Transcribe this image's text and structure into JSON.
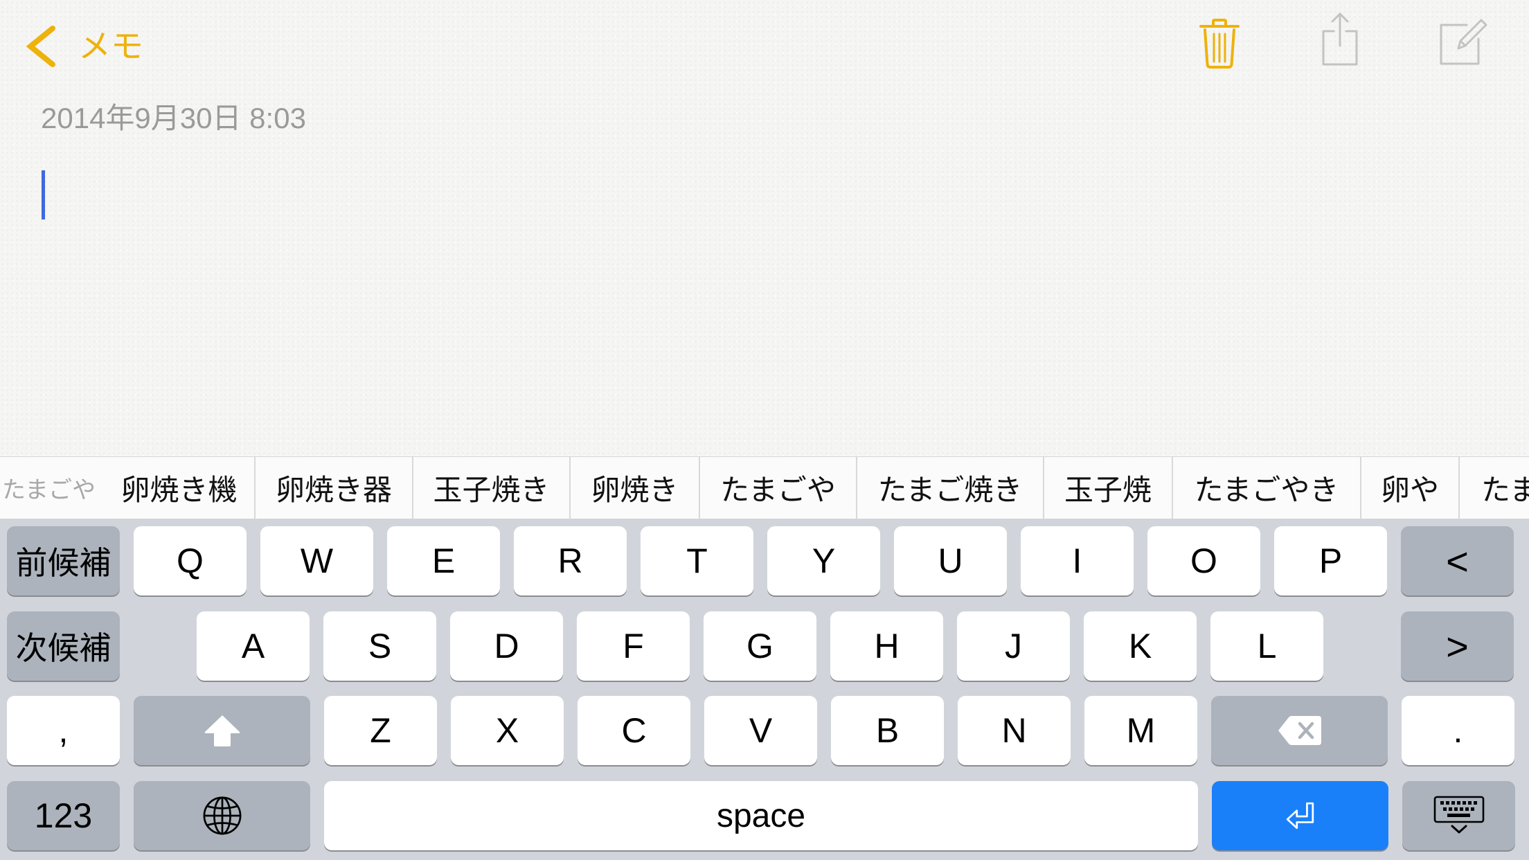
{
  "nav": {
    "back_label": "メモ",
    "back_icon": "chevron-left-icon",
    "trash_icon": "trash-icon",
    "share_icon": "share-icon",
    "compose_icon": "compose-icon"
  },
  "note": {
    "date": "2014年9月30日 8:03"
  },
  "candidates": {
    "reading": "たまごや",
    "items": [
      "卵焼き機",
      "卵焼き器",
      "玉子焼き",
      "卵焼き",
      "たまごや",
      "たまご焼き",
      "玉子焼",
      "たまごやき",
      "卵や",
      "たま"
    ]
  },
  "keyboard": {
    "row1": [
      "前候補",
      "Q",
      "W",
      "E",
      "R",
      "T",
      "Y",
      "U",
      "I",
      "O",
      "P",
      "<"
    ],
    "row2": [
      "次候補",
      "A",
      "S",
      "D",
      "F",
      "G",
      "H",
      "J",
      "K",
      "L",
      ">"
    ],
    "row3": {
      "comma": ",",
      "shift_icon": "shift-icon",
      "letters": [
        "Z",
        "X",
        "C",
        "V",
        "B",
        "N",
        "M"
      ],
      "delete_icon": "delete-icon",
      "period": "."
    },
    "row4": {
      "numbers_label": "123",
      "globe_icon": "globe-icon",
      "space_label": "space",
      "return_icon": "return-icon",
      "dismiss_icon": "keyboard-dismiss-icon"
    }
  },
  "colors": {
    "accent": "#EDB20C",
    "inactive_icon": "#C3C3C3",
    "date_text": "#9A9A9A",
    "cursor": "#3E6AE0",
    "keyboard_background": "#D1D5DB",
    "function_key": "#ACB3BC",
    "letter_key": "#FFFFFF",
    "return_key": "#1A80FA",
    "candidate_reading": "#A8A8A8"
  }
}
